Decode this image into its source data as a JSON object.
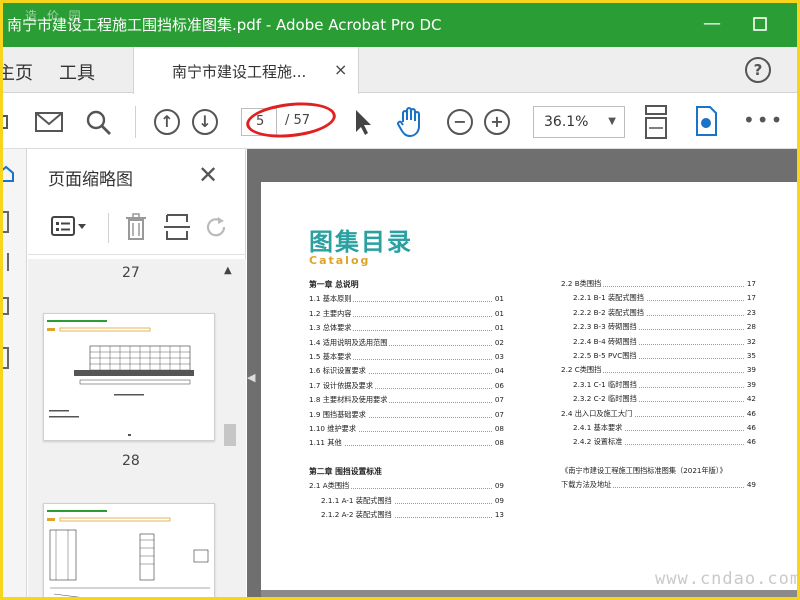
{
  "window": {
    "title": "南宁市建设工程施工围挡标准图集.pdf - Adobe Acrobat Pro DC",
    "watermark_top": "造 价 园",
    "min_icon": "minimize-icon",
    "max_icon": "maximize-icon"
  },
  "tabs": {
    "home": "主页",
    "tools": "工具",
    "doc": "南宁市建设工程施...",
    "close": "×",
    "help": "?"
  },
  "toolbar": {
    "page_current": "5",
    "page_total": "/ 57",
    "zoom": "36.1%",
    "icons": [
      "attach-icon",
      "mail-icon",
      "search-icon",
      "page-up-icon",
      "page-down-icon",
      "select-arrow-icon",
      "hand-tool-icon",
      "zoom-out-icon",
      "zoom-in-icon",
      "fit-page-icon",
      "scroll-mode-icon",
      "more-icon"
    ]
  },
  "panel": {
    "title": "页面缩略图",
    "thumb_labels": [
      "27",
      "28"
    ]
  },
  "document": {
    "catalog_title": "图集目录",
    "catalog_sub": "Catalog",
    "left_toc": [
      {
        "t": "第一章  总说明",
        "p": "",
        "head": true
      },
      {
        "t": "1.1 基本原则",
        "p": "01"
      },
      {
        "t": "1.2 主要内容",
        "p": "01"
      },
      {
        "t": "1.3 总体要求",
        "p": "01"
      },
      {
        "t": "1.4 适用说明及选用范围",
        "p": "02"
      },
      {
        "t": "1.5 基本要求",
        "p": "03"
      },
      {
        "t": "1.6 标识设置要求",
        "p": "04"
      },
      {
        "t": "1.7 设计依据及要求",
        "p": "06"
      },
      {
        "t": "1.8 主要材料及使用要求",
        "p": "07"
      },
      {
        "t": "1.9 围挡基础要求",
        "p": "07"
      },
      {
        "t": "1.10 维护要求",
        "p": "08"
      },
      {
        "t": "1.11 其他",
        "p": "08"
      },
      {
        "t": "",
        "p": "",
        "blank": true
      },
      {
        "t": "第二章  围挡设置标准",
        "p": "",
        "head": true
      },
      {
        "t": "2.1 A类围挡",
        "p": "09"
      },
      {
        "t": "2.1.1  A-1  装配式围挡",
        "p": "09",
        "indent": true
      },
      {
        "t": "2.1.2  A-2  装配式围挡",
        "p": "13",
        "indent": true
      }
    ],
    "right_toc": [
      {
        "t": "2.2 B类围挡",
        "p": "17"
      },
      {
        "t": "2.2.1 B-1 装配式围挡",
        "p": "17",
        "indent": true
      },
      {
        "t": "2.2.2 B-2 装配式围挡",
        "p": "23",
        "indent": true
      },
      {
        "t": "2.2.3 B-3 砖砌围挡",
        "p": "28",
        "indent": true
      },
      {
        "t": "2.2.4 B-4 砖砌围挡",
        "p": "32",
        "indent": true
      },
      {
        "t": "2.2.5 B-5 PVC围挡",
        "p": "35",
        "indent": true
      },
      {
        "t": "2.2 C类围挡",
        "p": "39"
      },
      {
        "t": "2.3.1 C-1 临时围挡",
        "p": "39",
        "indent": true
      },
      {
        "t": "2.3.2 C-2 临时围挡",
        "p": "42",
        "indent": true
      },
      {
        "t": "2.4 出入口及施工大门",
        "p": "46"
      },
      {
        "t": "2.4.1  基本要求",
        "p": "46",
        "indent": true
      },
      {
        "t": "2.4.2  设置标准",
        "p": "46",
        "indent": true
      },
      {
        "t": "",
        "p": "",
        "blank": true
      },
      {
        "t": "《南宁市建设工程施工围挡标准图集（2021年版）》",
        "p": "",
        "plain": true
      },
      {
        "t": "下载方法及地址",
        "p": "49"
      }
    ],
    "watermark": "www.cndao.com"
  }
}
